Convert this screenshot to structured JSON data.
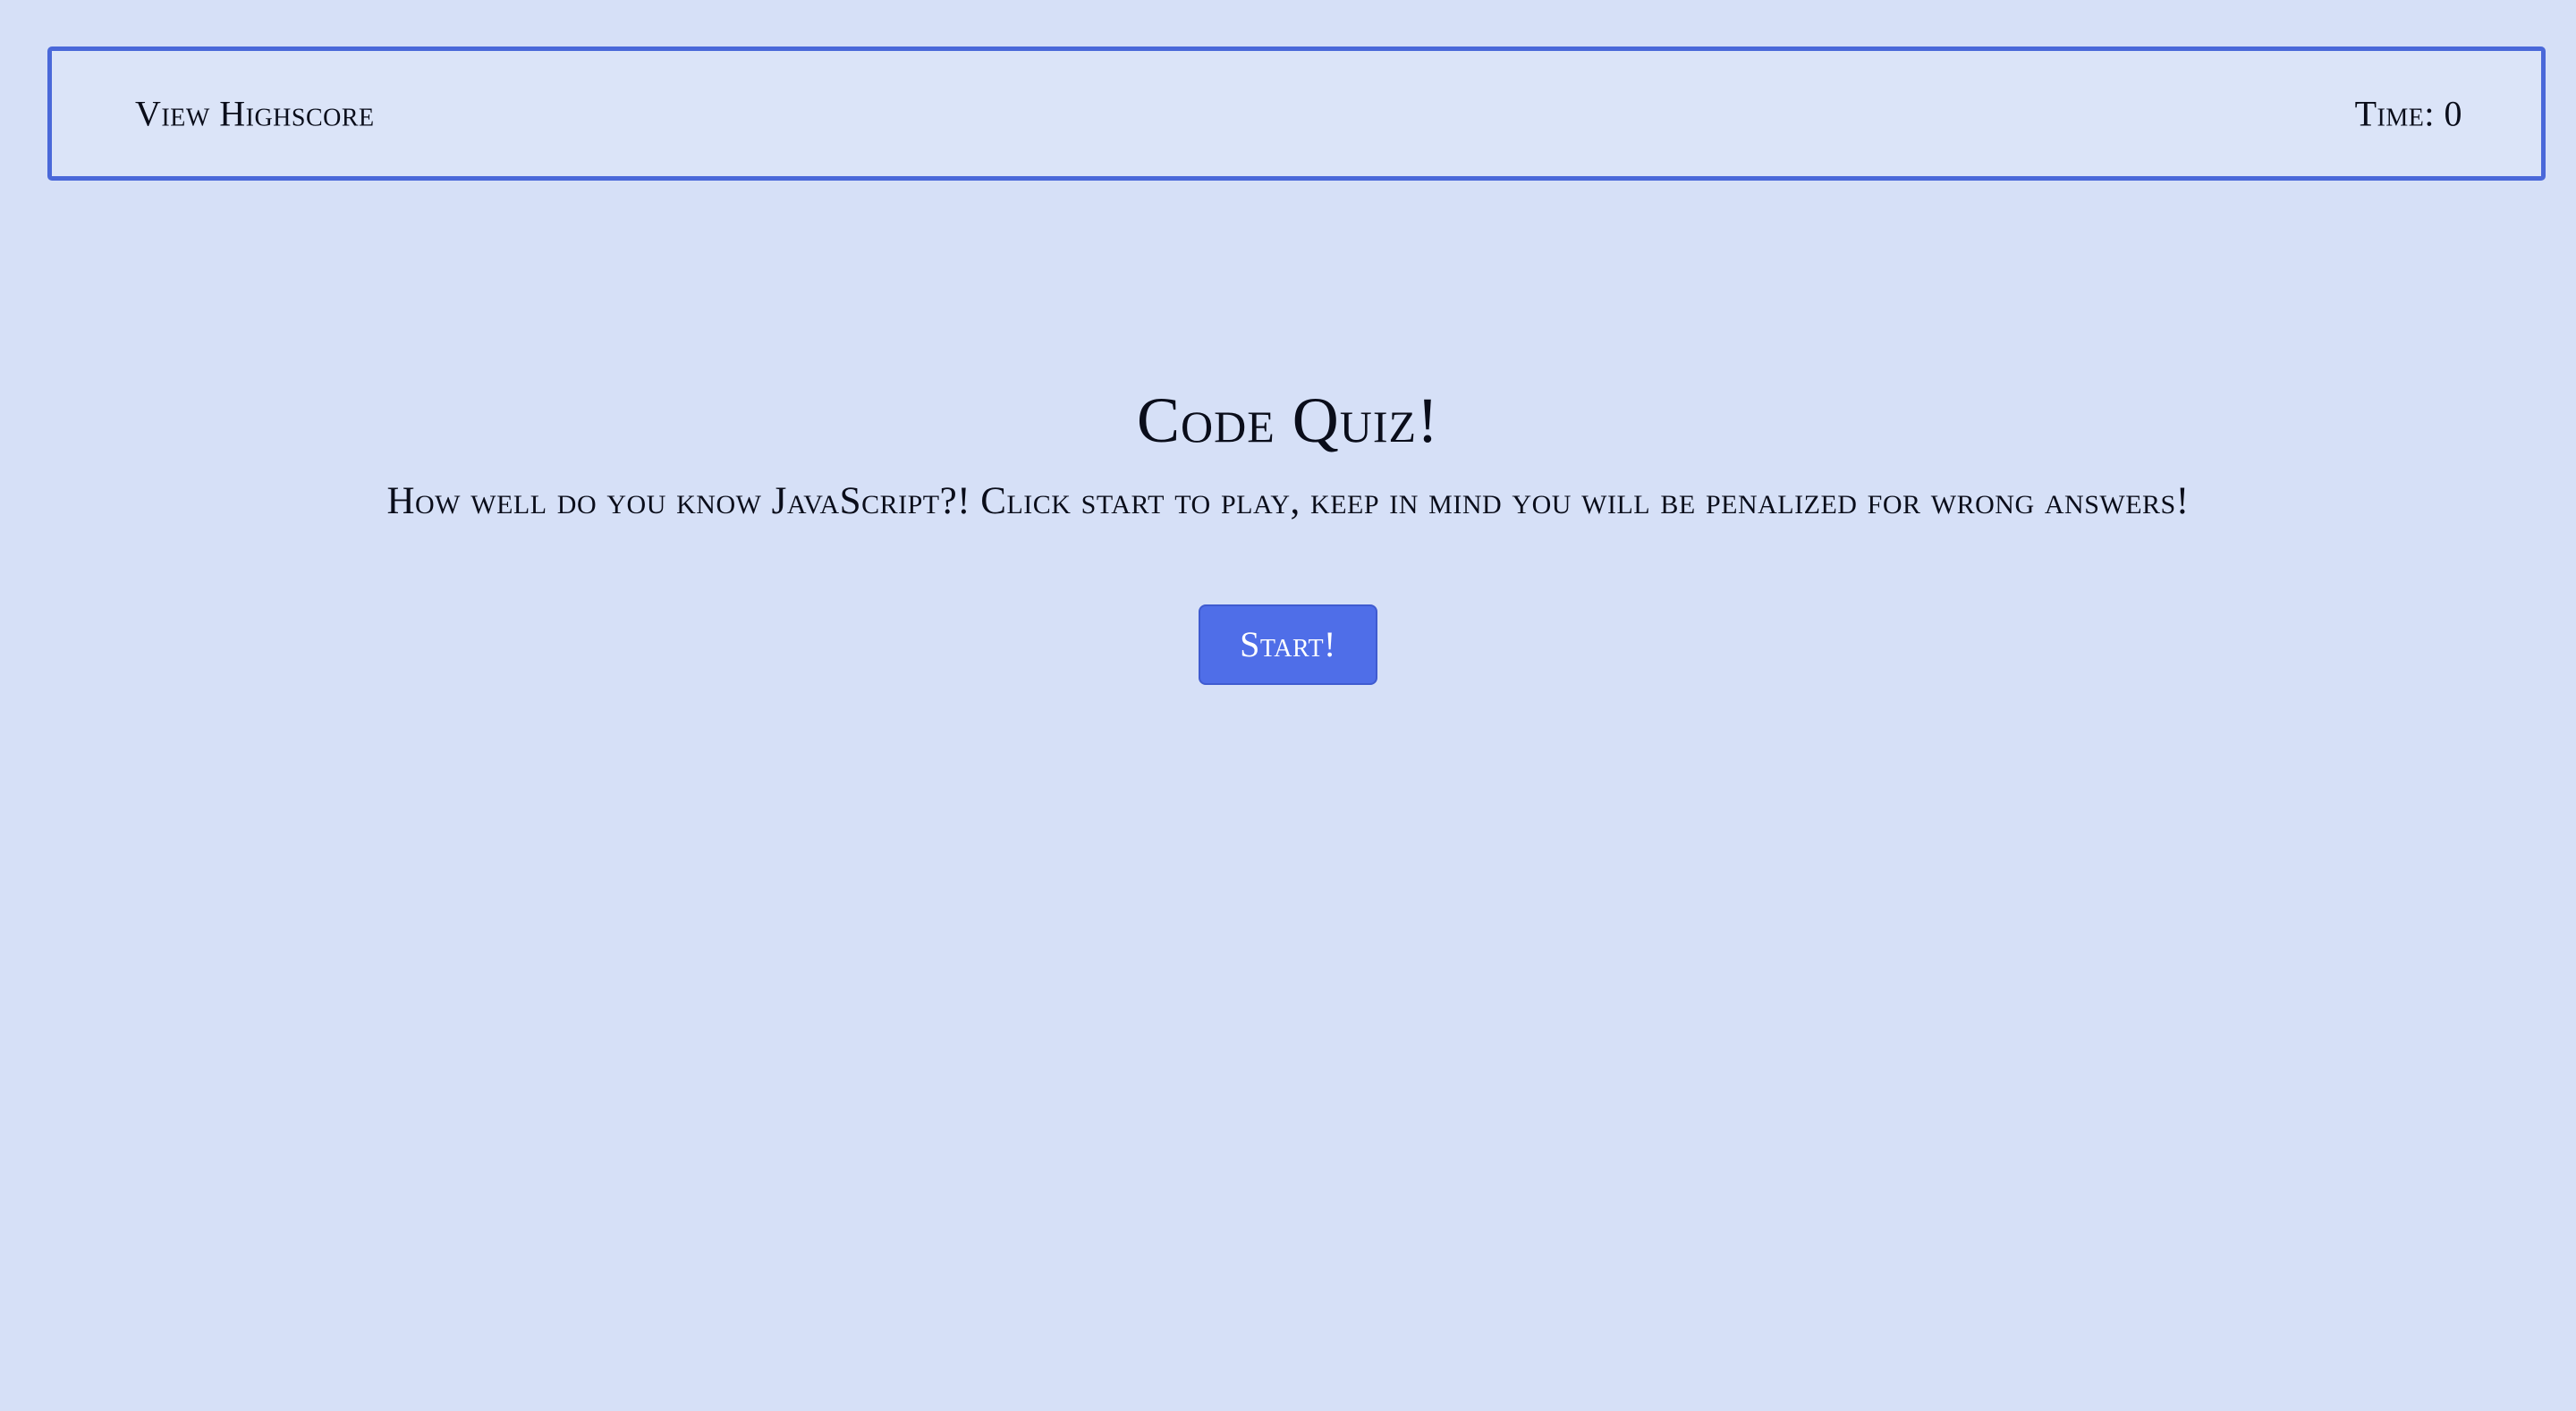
{
  "header": {
    "highscore_link": "View Highscore",
    "timer_label": "Time: 0"
  },
  "main": {
    "title": "Code Quiz!",
    "subtitle": "How well do you know JavaScript?! Click start to play, keep in mind you will be penalized for wrong answers!",
    "start_button": "Start!"
  },
  "colors": {
    "background": "#d6e0f7",
    "header_border": "#4a68d9",
    "button": "#4f6ee8"
  }
}
